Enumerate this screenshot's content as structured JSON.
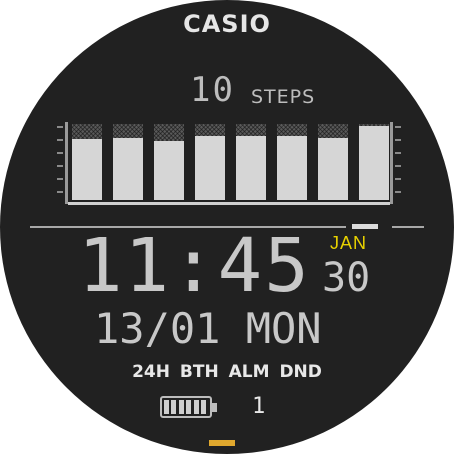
{
  "brand": "CASIO",
  "steps": {
    "count": "10",
    "label": "STEPS"
  },
  "activity_bars": [
    0.8,
    0.82,
    0.78,
    0.84,
    0.84,
    0.84,
    0.82,
    0.98
  ],
  "time": {
    "hours_minutes": "11:45",
    "seconds": "30",
    "month": "JAN"
  },
  "date": {
    "text": "13/01 MON"
  },
  "indicators": [
    "24H",
    "BTH",
    "ALM",
    "DND"
  ],
  "battery": {
    "level": 1.0
  },
  "notifications": {
    "count": "1"
  },
  "colors": {
    "background": "#212121",
    "text": "#c8c8c8",
    "accent": "#e8d200",
    "indicator": "#e0a82e"
  }
}
